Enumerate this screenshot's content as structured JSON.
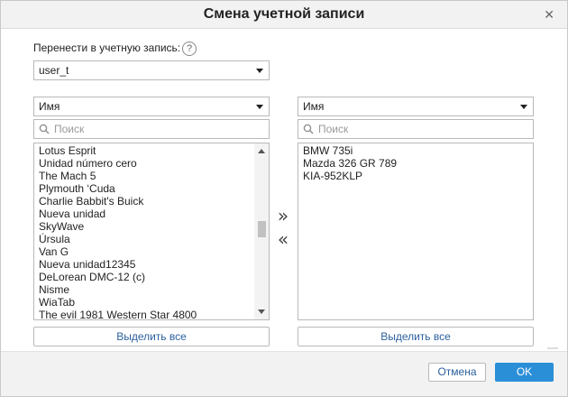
{
  "dialog": {
    "title": "Смена учетной записи",
    "close_icon": "close-icon"
  },
  "transfer": {
    "label": "Перенести в учетную запись:",
    "help_glyph": "?",
    "account_value": "user_t"
  },
  "left_panel": {
    "sort_value": "Имя",
    "search_placeholder": "Поиск",
    "items": [
      "Lotus Esprit",
      "Unidad número cero",
      "The Mach 5",
      "Plymouth ‘Cuda",
      "Charlie Babbit's Buick",
      "Nueva unidad",
      "SkyWave",
      "Úrsula",
      "Van G",
      "Nueva unidad12345",
      "DeLorean DMC-12 (c)",
      "Nisme",
      "WiaTab",
      "The evil 1981 Western Star 4800"
    ],
    "select_all_label": "Выделить все"
  },
  "right_panel": {
    "sort_value": "Имя",
    "search_placeholder": "Поиск",
    "items": [
      "BMW 735i",
      "Mazda 326 GR 789",
      "KIA-952KLP"
    ],
    "select_all_label": "Выделить все"
  },
  "move_buttons": {
    "move_right": "»",
    "move_left": "«"
  },
  "footer": {
    "cancel_label": "Отмена",
    "ok_label": "OK"
  },
  "colors": {
    "accent": "#2b8fd8",
    "link": "#2a5f9e",
    "header_bg": "#f2f2f2"
  }
}
